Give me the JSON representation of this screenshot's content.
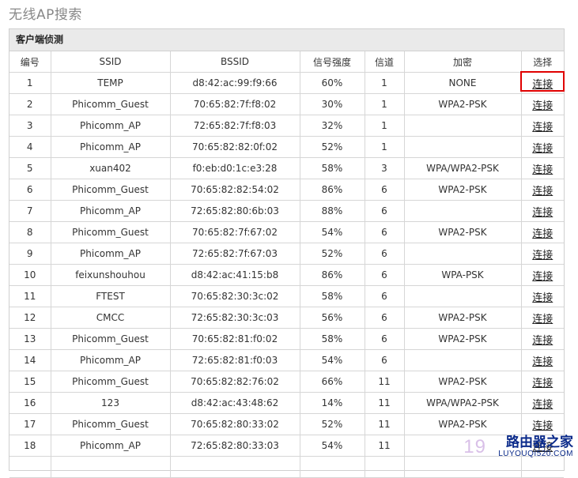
{
  "page_title": "无线AP搜索",
  "panel_title": "客户端侦测",
  "columns": [
    "编号",
    "SSID",
    "BSSID",
    "信号强度",
    "信道",
    "加密",
    "选择"
  ],
  "connect_label": "连接",
  "rows": [
    {
      "no": "1",
      "ssid": "TEMP",
      "bssid": "d8:42:ac:99:f9:66",
      "signal": "60%",
      "channel": "1",
      "encryption": "NONE"
    },
    {
      "no": "2",
      "ssid": "Phicomm_Guest",
      "bssid": "70:65:82:7f:f8:02",
      "signal": "30%",
      "channel": "1",
      "encryption": "WPA2-PSK"
    },
    {
      "no": "3",
      "ssid": "Phicomm_AP",
      "bssid": "72:65:82:7f:f8:03",
      "signal": "32%",
      "channel": "1",
      "encryption": ""
    },
    {
      "no": "4",
      "ssid": "Phicomm_AP",
      "bssid": "70:65:82:82:0f:02",
      "signal": "52%",
      "channel": "1",
      "encryption": ""
    },
    {
      "no": "5",
      "ssid": "xuan402",
      "bssid": "f0:eb:d0:1c:e3:28",
      "signal": "58%",
      "channel": "3",
      "encryption": "WPA/WPA2-PSK"
    },
    {
      "no": "6",
      "ssid": "Phicomm_Guest",
      "bssid": "70:65:82:82:54:02",
      "signal": "86%",
      "channel": "6",
      "encryption": "WPA2-PSK"
    },
    {
      "no": "7",
      "ssid": "Phicomm_AP",
      "bssid": "72:65:82:80:6b:03",
      "signal": "88%",
      "channel": "6",
      "encryption": ""
    },
    {
      "no": "8",
      "ssid": "Phicomm_Guest",
      "bssid": "70:65:82:7f:67:02",
      "signal": "54%",
      "channel": "6",
      "encryption": "WPA2-PSK"
    },
    {
      "no": "9",
      "ssid": "Phicomm_AP",
      "bssid": "72:65:82:7f:67:03",
      "signal": "52%",
      "channel": "6",
      "encryption": ""
    },
    {
      "no": "10",
      "ssid": "feixunshouhou",
      "bssid": "d8:42:ac:41:15:b8",
      "signal": "86%",
      "channel": "6",
      "encryption": "WPA-PSK"
    },
    {
      "no": "11",
      "ssid": "FTEST",
      "bssid": "70:65:82:30:3c:02",
      "signal": "58%",
      "channel": "6",
      "encryption": ""
    },
    {
      "no": "12",
      "ssid": "CMCC",
      "bssid": "72:65:82:30:3c:03",
      "signal": "56%",
      "channel": "6",
      "encryption": "WPA2-PSK"
    },
    {
      "no": "13",
      "ssid": "Phicomm_Guest",
      "bssid": "70:65:82:81:f0:02",
      "signal": "58%",
      "channel": "6",
      "encryption": "WPA2-PSK"
    },
    {
      "no": "14",
      "ssid": "Phicomm_AP",
      "bssid": "72:65:82:81:f0:03",
      "signal": "54%",
      "channel": "6",
      "encryption": ""
    },
    {
      "no": "15",
      "ssid": "Phicomm_Guest",
      "bssid": "70:65:82:82:76:02",
      "signal": "66%",
      "channel": "11",
      "encryption": "WPA2-PSK"
    },
    {
      "no": "16",
      "ssid": "123",
      "bssid": "d8:42:ac:43:48:62",
      "signal": "14%",
      "channel": "11",
      "encryption": "WPA/WPA2-PSK"
    },
    {
      "no": "17",
      "ssid": "Phicomm_Guest",
      "bssid": "70:65:82:80:33:02",
      "signal": "52%",
      "channel": "11",
      "encryption": "WPA2-PSK"
    },
    {
      "no": "18",
      "ssid": "Phicomm_AP",
      "bssid": "72:65:82:80:33:03",
      "signal": "54%",
      "channel": "11",
      "encryption": ""
    },
    {
      "no": "",
      "ssid": "",
      "bssid": "",
      "signal": "",
      "channel": "",
      "encryption": ""
    }
  ],
  "watermark": {
    "number": "19",
    "brand": "路由器之家",
    "domain": "LUYOUQI520.COM"
  },
  "colors": {
    "highlight": "#e00000",
    "header_bg": "#eaeaea",
    "border": "#d6d6d6"
  }
}
